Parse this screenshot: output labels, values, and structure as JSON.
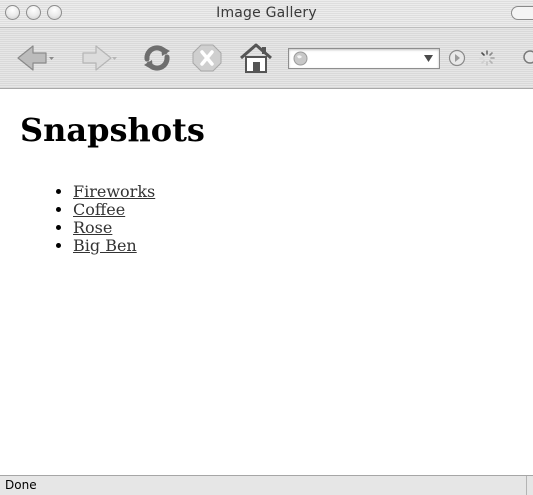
{
  "window": {
    "title": "Image Gallery"
  },
  "toolbar": {
    "back_icon": "back-arrow-icon",
    "forward_icon": "forward-arrow-icon",
    "reload_icon": "reload-icon",
    "stop_icon": "stop-icon",
    "home_icon": "home-icon",
    "url_value": "",
    "go_icon": "go-icon",
    "throbber_icon": "throbber-icon"
  },
  "page": {
    "heading": "Snapshots",
    "links": [
      "Fireworks",
      "Coffee",
      "Rose",
      "Big Ben"
    ]
  },
  "status": {
    "text": "Done"
  },
  "colors": {
    "link": "#333333",
    "chrome": "#e0e0e0"
  }
}
